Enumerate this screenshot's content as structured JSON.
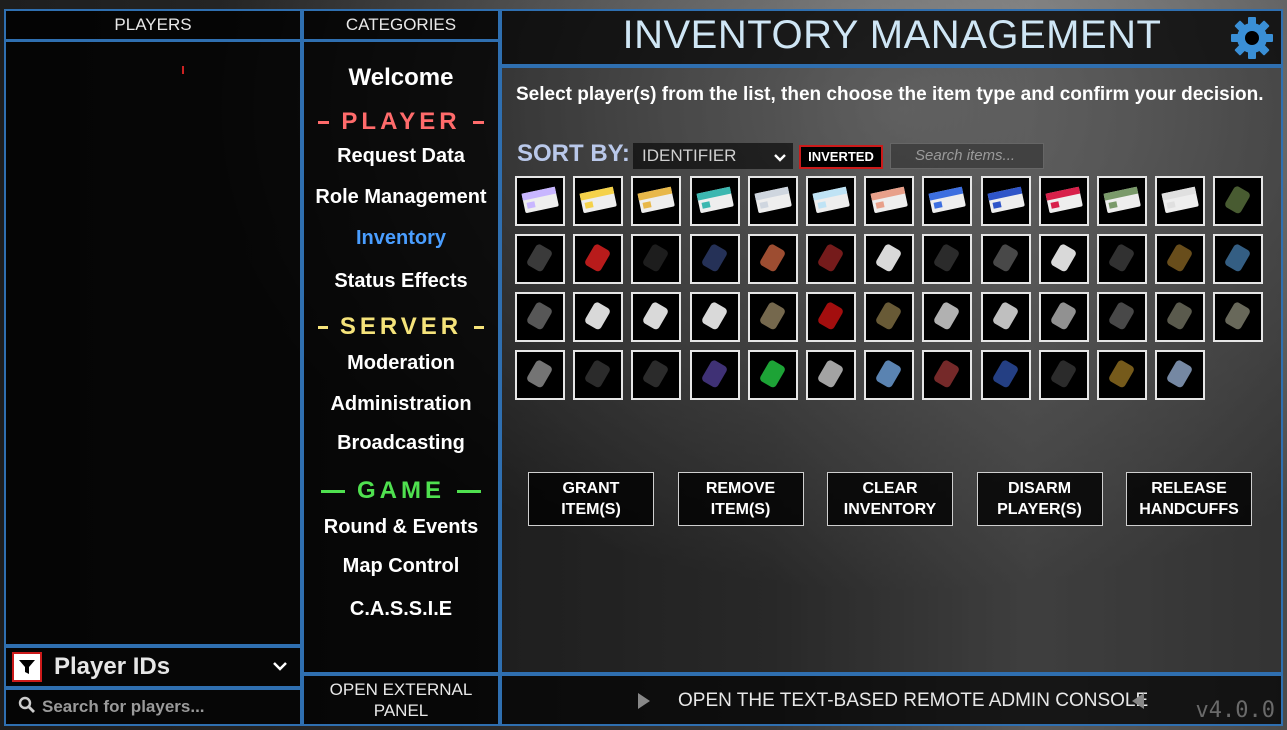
{
  "players_panel": {
    "header": "PLAYERS",
    "filter_label": "Player IDs",
    "search_placeholder": "Search for players..."
  },
  "categories_panel": {
    "header": "CATEGORIES",
    "welcome": "Welcome",
    "player_section": "PLAYER",
    "player_items": [
      "Request Data",
      "Role Management",
      "Inventory",
      "Status Effects"
    ],
    "server_section": "SERVER",
    "server_items": [
      "Moderation",
      "Administration",
      "Broadcasting"
    ],
    "game_section": "GAME",
    "game_items": [
      "Round & Events",
      "Map Control",
      "C.A.S.S.I.E"
    ],
    "external_panel": "OPEN EXTERNAL\nPANEL",
    "selected_item": "Inventory"
  },
  "main": {
    "title": "INVENTORY MANAGEMENT",
    "instructions": "Select player(s) from the list, then choose the item type and confirm your decision.",
    "sort_label": "SORT BY:",
    "sort_value": "IDENTIFIER",
    "inverted_label": "INVERTED",
    "search_placeholder": "Search items...",
    "buttons": [
      "GRANT\nITEM(S)",
      "REMOVE\nITEM(S)",
      "CLEAR\nINVENTORY",
      "DISARM\nPLAYER(S)",
      "RELEASE\nHANDCUFFS"
    ],
    "console_label": "OPEN THE TEXT-BASED REMOTE ADMIN CONSOLE",
    "version": "v4.0.0"
  },
  "items": [
    "keycard-janitor",
    "keycard-scientist",
    "keycard-research-supervisor",
    "keycard-zone-manager",
    "keycard-guard",
    "keycard-mtf-private",
    "keycard-containment-engineer",
    "keycard-mtf-operative",
    "keycard-mtf-captain",
    "keycard-facility-manager",
    "keycard-chaos-insurgency",
    "keycard-o5",
    "radio",
    "com-15",
    "medkit",
    "flashlight",
    "micro-hid",
    "scp-500",
    "scp-207",
    "ammo-12ga",
    "epsilon-11",
    "crossvec",
    "ammo-556",
    "fsp-9",
    "logicer",
    "grenade-frag",
    "grenade-flash",
    "ammo-44",
    "ammo-762",
    "ammo-9mm",
    "com-18",
    "scp-018",
    "scp-268",
    "adrenaline",
    "painkillers",
    "coin",
    "armor-light",
    "armor-combat",
    "armor-heavy",
    "revolver",
    "shotgun",
    "ak",
    "scp-244a",
    "scp-2176",
    "scp-244b",
    "scp-1853",
    "scp-1576",
    "particle-disruptor",
    "com-45",
    "jailbird",
    "lantern"
  ],
  "colors": {
    "border": "#2f6fb0",
    "player": "#ff6b6b",
    "server": "#f5e37a",
    "game": "#4fe04f",
    "selected": "#4a9eff",
    "inverted": "#cc1a1a"
  }
}
